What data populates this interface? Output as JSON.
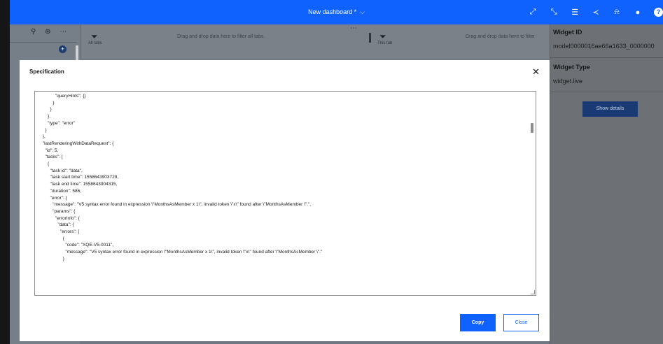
{
  "topbar": {
    "dashboard_title": "New dashboard *",
    "title_chevron": "⌵",
    "icons": {
      "expand": "⤢",
      "pin": "⤡",
      "filter": "☰",
      "share": "≺",
      "notifications": "⍾",
      "user": "●",
      "help": "?"
    }
  },
  "left_panel": {
    "tools": "⚲ ⊕ ⋯",
    "add": "+"
  },
  "filterbar": {
    "all_tabs_label": "All tabs",
    "all_tabs_hint": "Drag and drop data here to filter all tabs.",
    "more": "⋯",
    "this_tab_label": "This tab",
    "this_tab_hint": "Drag and drop data here to filter"
  },
  "side_panel": {
    "widget_id_label": "Widget ID",
    "widget_id_value": "model0000016ae66a1633_0000000",
    "widget_type_label": "Widget Type",
    "widget_type_value": "widget.live",
    "show_details_label": "Show details"
  },
  "modal": {
    "title": "Specification",
    "close_glyph": "✕",
    "copy_label": "Copy",
    "close_label": "Close",
    "code_lines": [
      "                \"queryHints\": {}",
      "              }",
      "            }",
      "          },",
      "          \"type\": \"error\"",
      "        }",
      "      },",
      "      \"lastRenderingWithDataRequest\": {",
      "        \"id\": 5,",
      "        \"tasks\": [",
      "          {",
      "            \"task id\": \"data\",",
      "            \"task start time\": 1558643903729,",
      "            \"task end time\": 1558643904315,",
      "            \"duration\": 586,",
      "            \"error\": {",
      "              \"message\": \"V5 syntax error found in expression \\\"MonthsAsMember x 1\\\", invalid token \\\"x\\\" found after \\\"MonthsAsMember \\\".\",",
      "              \"params\": {",
      "                \"errorInfo\": {",
      "                  \"data\": {",
      "                    \"errors\": [",
      "                      {",
      "                        \"code\": \"XQE-V5-0011\",",
      "                        \"message\": \"V5 syntax error found in expression \\\"MonthsAsMember x 1\\\", invalid token \\\"x\\\" found after \\\"MonthsAsMember \\\".\"",
      "                      }"
    ]
  }
}
